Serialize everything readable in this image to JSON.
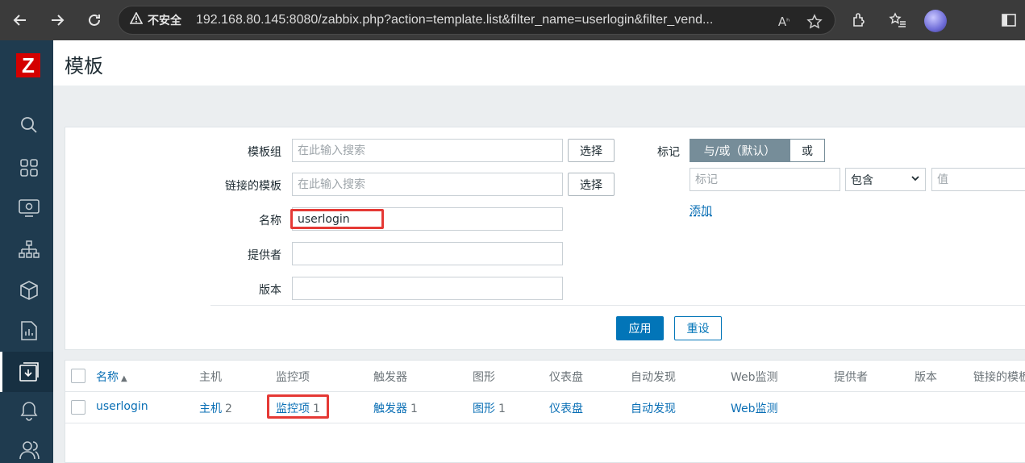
{
  "browser": {
    "security_label": "不安全",
    "url": "192.168.80.145:8080/zabbix.php?action=template.list&filter_name=userlogin&filter_vend..."
  },
  "sidebar": {
    "logo": "Z",
    "icons": [
      "search-icon",
      "dashboard-icon",
      "monitoring-icon",
      "services-icon",
      "inventory-icon",
      "reports-icon",
      "data-collection-icon",
      "alerts-icon",
      "users-icon"
    ]
  },
  "page": {
    "title": "模板"
  },
  "filter": {
    "template_group_label": "模板组",
    "template_group_placeholder": "在此输入搜索",
    "linked_templates_label": "链接的模板",
    "linked_templates_placeholder": "在此输入搜索",
    "select_label": "选择",
    "name_label": "名称",
    "name_value": "userlogin",
    "vendor_label": "提供者",
    "vendor_value": "",
    "version_label": "版本",
    "version_value": "",
    "tags_label": "标记",
    "tags_and_or": "与/或（默认）",
    "tags_or": "或",
    "tag_placeholder": "标记",
    "tag_operator": "包含",
    "tag_value_placeholder": "值",
    "add_label": "添加",
    "apply_label": "应用",
    "reset_label": "重设"
  },
  "table": {
    "headers": {
      "name": "名称",
      "sort_indicator": "▲",
      "hosts": "主机",
      "items": "监控项",
      "triggers": "触发器",
      "graphs": "图形",
      "dashboards": "仪表盘",
      "discovery": "自动发现",
      "web": "Web监测",
      "vendor": "提供者",
      "version": "版本",
      "linked": "链接的模板"
    },
    "rows": [
      {
        "name": "userlogin",
        "hosts": "主机",
        "hosts_count": "2",
        "items": "监控项",
        "items_count": "1",
        "triggers": "触发器",
        "triggers_count": "1",
        "graphs": "图形",
        "graphs_count": "1",
        "dashboards": "仪表盘",
        "discovery": "自动发现",
        "web": "Web监测"
      }
    ]
  },
  "colors": {
    "sidebar": "#1f3b4f",
    "link": "#0a6fb5",
    "primary_button": "#0275b8",
    "highlight": "#e53935",
    "logo": "#d40000"
  }
}
